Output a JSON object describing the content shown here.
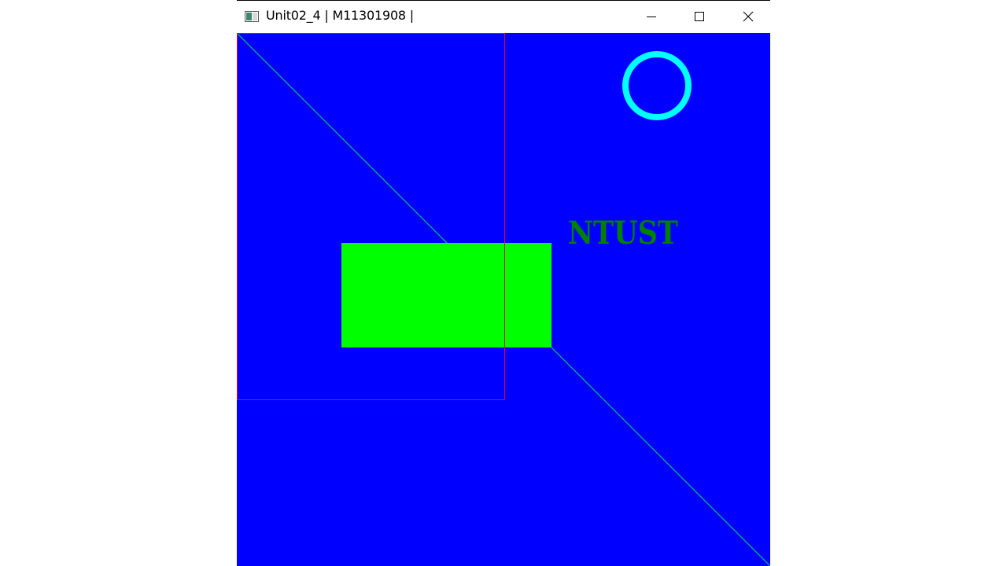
{
  "window": {
    "title": "Unit02_4 | M11301908 |",
    "controls": {
      "minimize": "minimize-icon",
      "maximize": "maximize-icon",
      "close": "close-icon"
    }
  },
  "scene": {
    "text": "NTUST",
    "colors": {
      "background": "#0000ff",
      "diagonal_line": "#00c060",
      "rectangle_outline": "#ff0000",
      "filled_rectangle": "#00ff00",
      "circle": "#00ffff",
      "text": "#008000"
    }
  }
}
